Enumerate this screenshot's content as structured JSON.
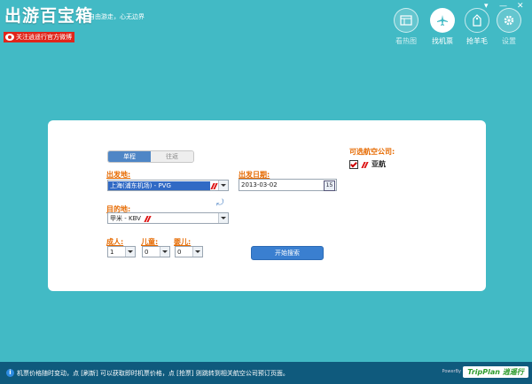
{
  "header": {
    "title": "出游百宝箱",
    "slogan": "自由游走，心无边界",
    "weibo_label": "关注逍遥行官方微博"
  },
  "window_controls": {
    "menu": "▾",
    "minimize": "—",
    "close": "✕"
  },
  "toolbar": [
    {
      "label": "看热图",
      "icon": "heatmap-icon",
      "state": "disabled"
    },
    {
      "label": "找机票",
      "icon": "plane-icon",
      "state": "active"
    },
    {
      "label": "抢羊毛",
      "icon": "tag-icon",
      "state": "normal"
    },
    {
      "label": "设置",
      "icon": "gear-icon",
      "state": "disabled"
    }
  ],
  "search": {
    "tabs": [
      "单程",
      "往返"
    ],
    "active_tab": "单程",
    "from_label": "出发地:",
    "from_value": "上海(浦东机场) - PVG",
    "to_label": "目的地:",
    "to_value": "甲米 - KBV",
    "date_label": "出发日期:",
    "date_value": "2013-03-02",
    "calendar_day": "15",
    "adult_label": "成人:",
    "adult_value": "1",
    "child_label": "儿童:",
    "child_value": "0",
    "infant_label": "婴儿:",
    "infant_value": "0",
    "search_button": "开始搜索"
  },
  "airlines": {
    "header": "可选航空公司:",
    "items": [
      {
        "name": "亚航",
        "checked": true
      }
    ]
  },
  "status_bar": {
    "message": "机票价格随时变动，点 [刷新] 可以获取即时机票价格，点 [抢票] 则跳转到相关航空公司预订页面。",
    "powered_by": "PowerBy",
    "brand": "TripPlan 逍遥行"
  },
  "colors": {
    "background": "#42bac5",
    "accent": "#e66a00",
    "button": "#3a7fd0",
    "statusbar": "#0f5a7d"
  }
}
